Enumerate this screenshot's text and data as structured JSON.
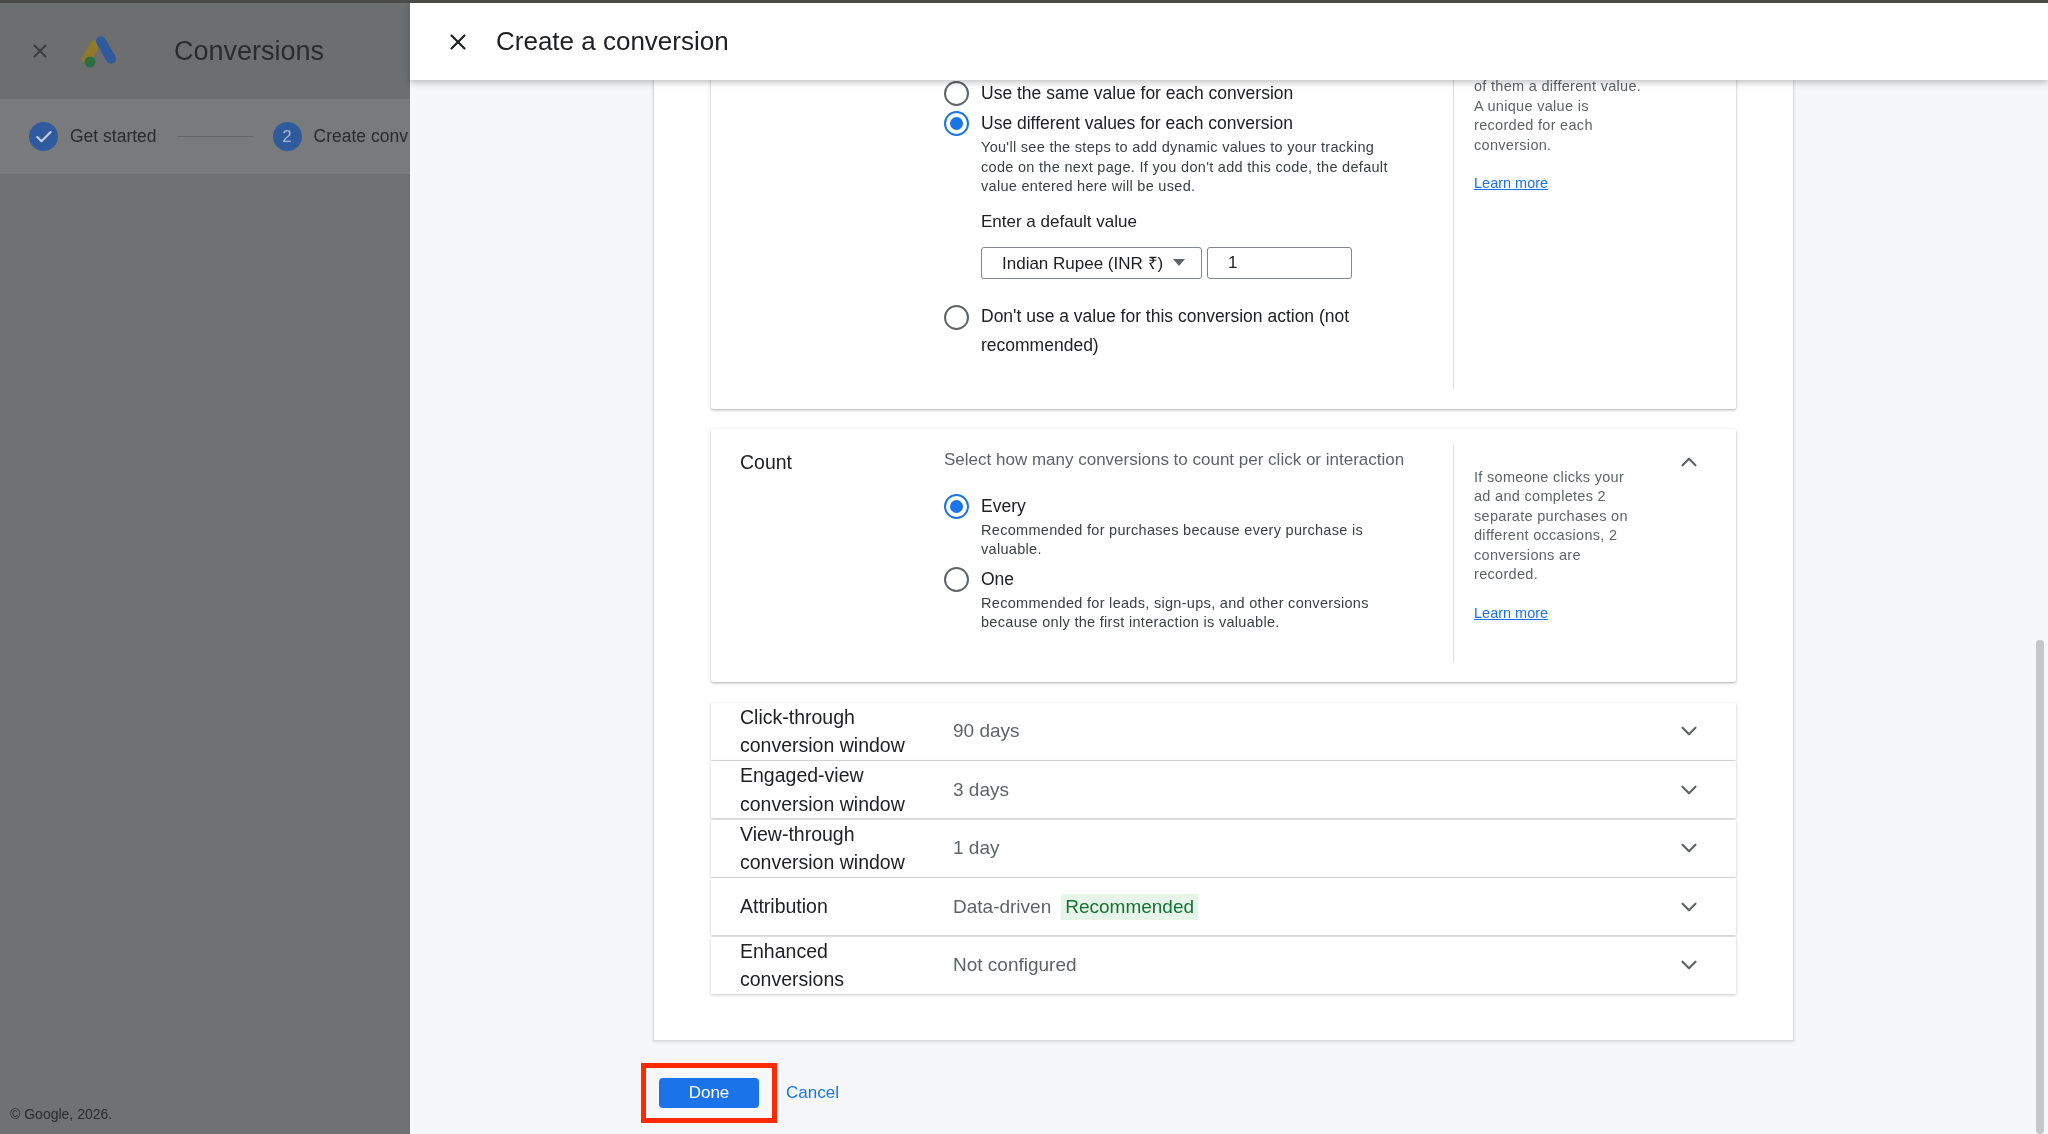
{
  "background_page": {
    "title": "Conversions",
    "steps": [
      {
        "label": "Get started",
        "completed": true
      },
      {
        "label": "Create conv",
        "number": "2",
        "completed": false
      }
    ],
    "footer": "© Google, 2026."
  },
  "panel": {
    "title": "Create a conversion",
    "value_card": {
      "options": [
        {
          "label": "Use the same value for each conversion",
          "selected": false
        },
        {
          "label": "Use different values for each conversion",
          "selected": true,
          "description": "You'll see the steps to add dynamic values to your tracking code on the next page. If you don't add this code, the default value entered here will be used.",
          "default_value": {
            "label": "Enter a default value",
            "currency": "Indian Rupee (INR ₹)",
            "value": "1"
          }
        },
        {
          "label": "Don't use a value for this conversion action (not recommended)",
          "selected": false
        }
      ],
      "help": "of them a different value. A unique value is recorded for each conversion.",
      "link": "Learn more"
    },
    "count_card": {
      "title": "Count",
      "prompt": "Select how many conversions to count per click or interaction",
      "expanded": true,
      "options": [
        {
          "label": "Every",
          "description": "Recommended for purchases because every purchase is valuable.",
          "selected": true
        },
        {
          "label": "One",
          "description": "Recommended for leads, sign-ups, and other conversions because only the first interaction is valuable.",
          "selected": false
        }
      ],
      "help": "If someone clicks your ad and completes 2 separate purchases on different occasions, 2 conversions are recorded.",
      "link": "Learn more"
    },
    "settings": [
      {
        "label": "Click-through conversion window",
        "value": "90 days",
        "expanded": false
      },
      {
        "label": "Engaged-view conversion window",
        "value": "3 days",
        "expanded": false
      },
      {
        "label": "View-through conversion window",
        "value": "1 day",
        "expanded": false
      },
      {
        "label": "Attribution",
        "value": "Data-driven",
        "badge": "Recommended",
        "expanded": false
      },
      {
        "label": "Enhanced conversions",
        "value": "Not configured",
        "expanded": false
      }
    ],
    "buttons": {
      "done": "Done",
      "cancel": "Cancel",
      "done_highlighted": true
    }
  }
}
